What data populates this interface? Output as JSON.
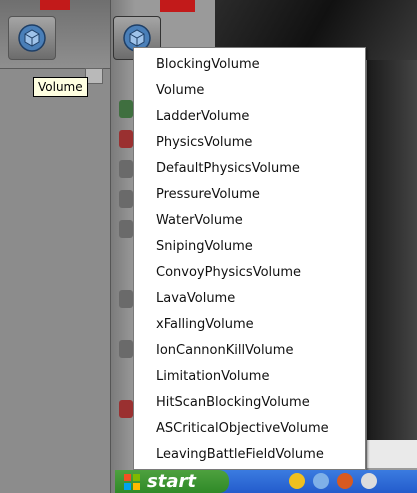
{
  "toolbar": {
    "tooltip": "Volume"
  },
  "context_menu": {
    "items": [
      "BlockingVolume",
      "Volume",
      "LadderVolume",
      "PhysicsVolume",
      "DefaultPhysicsVolume",
      "PressureVolume",
      "WaterVolume",
      "SnipingVolume",
      "ConvoyPhysicsVolume",
      "LavaVolume",
      "xFallingVolume",
      "IonCannonKillVolume",
      "LimitationVolume",
      "HitScanBlockingVolume",
      "ASCriticalObjectiveVolume",
      "LeavingBattleFieldVolume"
    ]
  },
  "taskbar": {
    "start_label": "start"
  },
  "colors": {
    "accent_red": "#c21a1a",
    "taskbar_blue": "#245ccc",
    "start_green": "#2f8a27"
  }
}
